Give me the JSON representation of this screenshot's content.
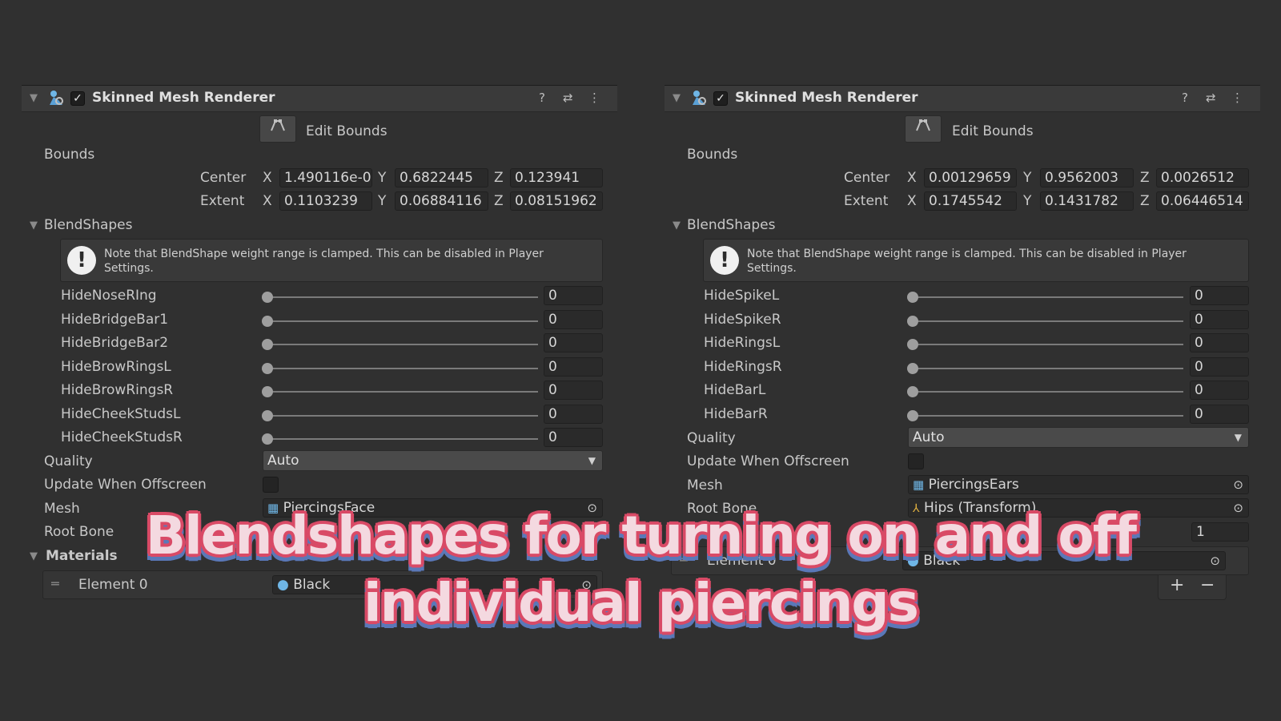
{
  "left": {
    "component_title": "Skinned Mesh Renderer",
    "edit_bounds_label": "Edit Bounds",
    "bounds_label": "Bounds",
    "center_label": "Center",
    "extent_label": "Extent",
    "center": {
      "x": "1.490116e-0",
      "y": "0.6822445",
      "z": "0.123941"
    },
    "extent": {
      "x": "0.1103239",
      "y": "0.06884116",
      "z": "0.08151962"
    },
    "blendshapes_label": "BlendShapes",
    "note_line1": "Note that BlendShape weight range is clamped. This can be disabled in Player",
    "note_line2": "Settings.",
    "blendshapes": [
      {
        "name": "HideNoseRIng",
        "value": "0"
      },
      {
        "name": "HideBridgeBar1",
        "value": "0"
      },
      {
        "name": "HideBridgeBar2",
        "value": "0"
      },
      {
        "name": "HideBrowRingsL",
        "value": "0"
      },
      {
        "name": "HideBrowRingsR",
        "value": "0"
      },
      {
        "name": "HideCheekStudsL",
        "value": "0"
      },
      {
        "name": "HideCheekStudsR",
        "value": "0"
      }
    ],
    "quality_label": "Quality",
    "quality_value": "Auto",
    "update_offscreen_label": "Update When Offscreen",
    "mesh_label": "Mesh",
    "mesh_value": "PiercingsFace",
    "root_bone_label": "Root Bone",
    "materials_label": "Materials",
    "element0_label": "Element 0",
    "element0_value": "Black"
  },
  "right": {
    "component_title": "Skinned Mesh Renderer",
    "edit_bounds_label": "Edit Bounds",
    "bounds_label": "Bounds",
    "center_label": "Center",
    "extent_label": "Extent",
    "center": {
      "x": "0.00129659",
      "y": "0.9562003",
      "z": "0.0026512"
    },
    "extent": {
      "x": "0.1745542",
      "y": "0.1431782",
      "z": "0.06446514"
    },
    "blendshapes_label": "BlendShapes",
    "note_line1": "Note that BlendShape weight range is clamped. This can be disabled in Player",
    "note_line2": "Settings.",
    "blendshapes": [
      {
        "name": "HideSpikeL",
        "value": "0"
      },
      {
        "name": "HideSpikeR",
        "value": "0"
      },
      {
        "name": "HideRingsL",
        "value": "0"
      },
      {
        "name": "HideRingsR",
        "value": "0"
      },
      {
        "name": "HideBarL",
        "value": "0"
      },
      {
        "name": "HideBarR",
        "value": "0"
      }
    ],
    "quality_label": "Quality",
    "quality_value": "Auto",
    "update_offscreen_label": "Update When Offscreen",
    "mesh_label": "Mesh",
    "mesh_value": "PiercingsEars",
    "root_bone_label": "Root Bone",
    "root_bone_value": "Hips (Transform)",
    "materials_size_value": "1",
    "element0_label": "Element 0",
    "element0_value": "Black",
    "plus_label": "+",
    "minus_label": "−"
  },
  "axis": {
    "x": "X",
    "y": "Y",
    "z": "Z"
  },
  "overlay": {
    "line1": "Blendshapes for turning on and off",
    "line2": "individual piercings"
  },
  "colors": {
    "background": "#303030",
    "header": "#3a3a3a",
    "overlay_fill": "#f4d9e0",
    "overlay_outline": "#d94a66",
    "overlay_shadow": "#5a78b8"
  }
}
